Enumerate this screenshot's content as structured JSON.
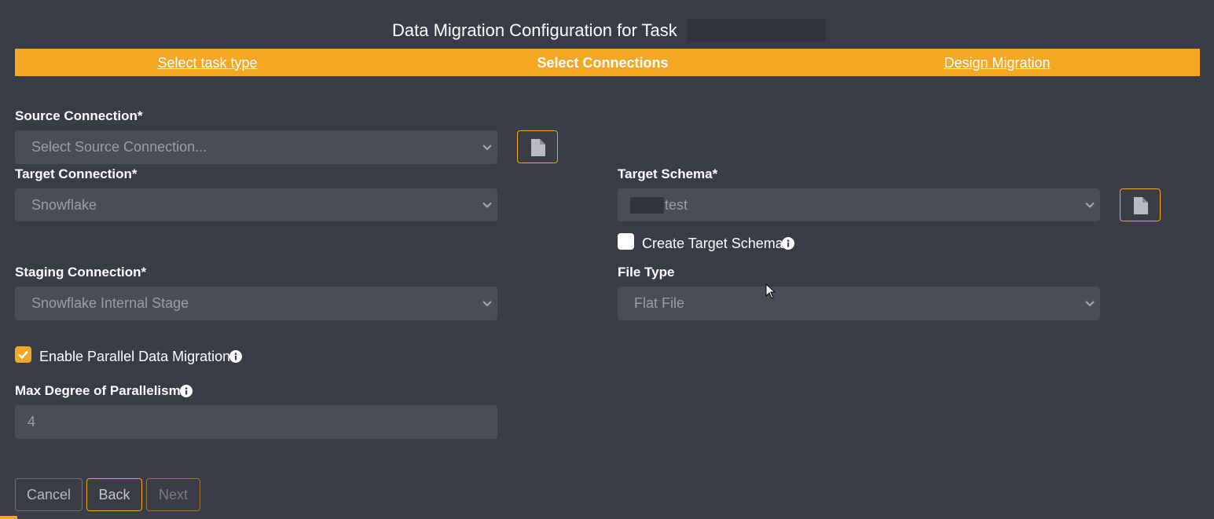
{
  "header": {
    "title": "Data Migration Configuration for Task"
  },
  "steps": [
    {
      "label": "Select task type",
      "state": "link"
    },
    {
      "label": "Select Connections",
      "state": "active"
    },
    {
      "label": "Design Migration",
      "state": "link"
    }
  ],
  "source": {
    "label": "Source Connection*",
    "placeholder": "Select Source Connection..."
  },
  "target": {
    "label": "Target Connection*",
    "value": "Snowflake"
  },
  "schema": {
    "label": "Target Schema*",
    "value": "test",
    "create_label": "Create Target Schema",
    "create_checked": false
  },
  "staging": {
    "label": "Staging Connection*",
    "value": "Snowflake Internal Stage"
  },
  "filetype": {
    "label": "File Type",
    "value": "Flat File"
  },
  "parallel": {
    "enable_label": "Enable Parallel Data Migration",
    "enabled": true,
    "max_label": "Max Degree of Parallelism",
    "max_value": "4"
  },
  "buttons": {
    "cancel": "Cancel",
    "back": "Back",
    "next": "Next"
  },
  "colors": {
    "accent": "#f5a623",
    "background": "#393c46",
    "field": "#4a4d56"
  },
  "icons": {
    "file": "file-icon",
    "info": "info-icon",
    "chevron": "chevron-down-icon",
    "check": "check-icon"
  }
}
